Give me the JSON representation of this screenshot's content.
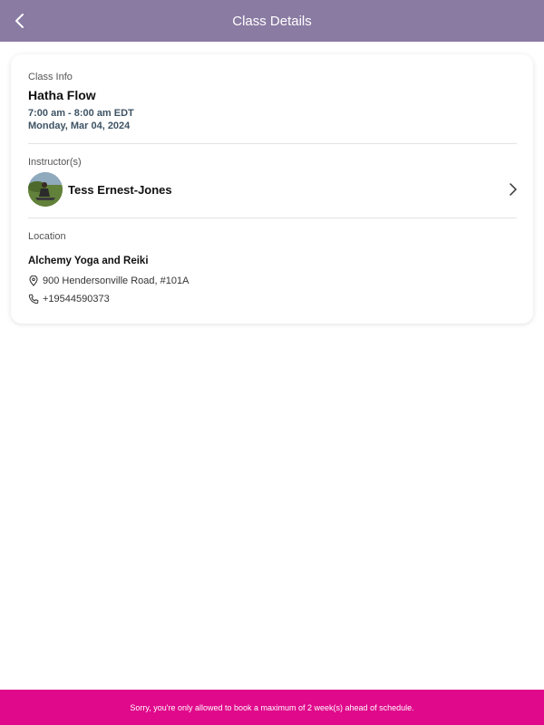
{
  "header": {
    "title": "Class Details",
    "back_icon": "chevron-left-icon"
  },
  "class_info": {
    "label": "Class Info",
    "name": "Hatha Flow",
    "time": "7:00 am - 8:00 am EDT",
    "date": "Monday, Mar 04, 2024"
  },
  "instructors": {
    "label": "Instructor(s)",
    "items": [
      {
        "name": "Tess Ernest-Jones",
        "avatar": "instructor-photo",
        "chevron_icon": "chevron-right-icon"
      }
    ]
  },
  "location": {
    "label": "Location",
    "name": "Alchemy Yoga and Reiki",
    "address": "900 Hendersonville Road, #101A",
    "address_icon": "map-pin-icon",
    "phone": "+19544590373",
    "phone_icon": "phone-icon"
  },
  "footer": {
    "message": "Sorry, you're only allowed to book a maximum of 2 week(s) ahead of schedule."
  },
  "colors": {
    "header_bg": "#8a7ba2",
    "footer_bg": "#e0088b",
    "time_text": "#3e5365"
  }
}
